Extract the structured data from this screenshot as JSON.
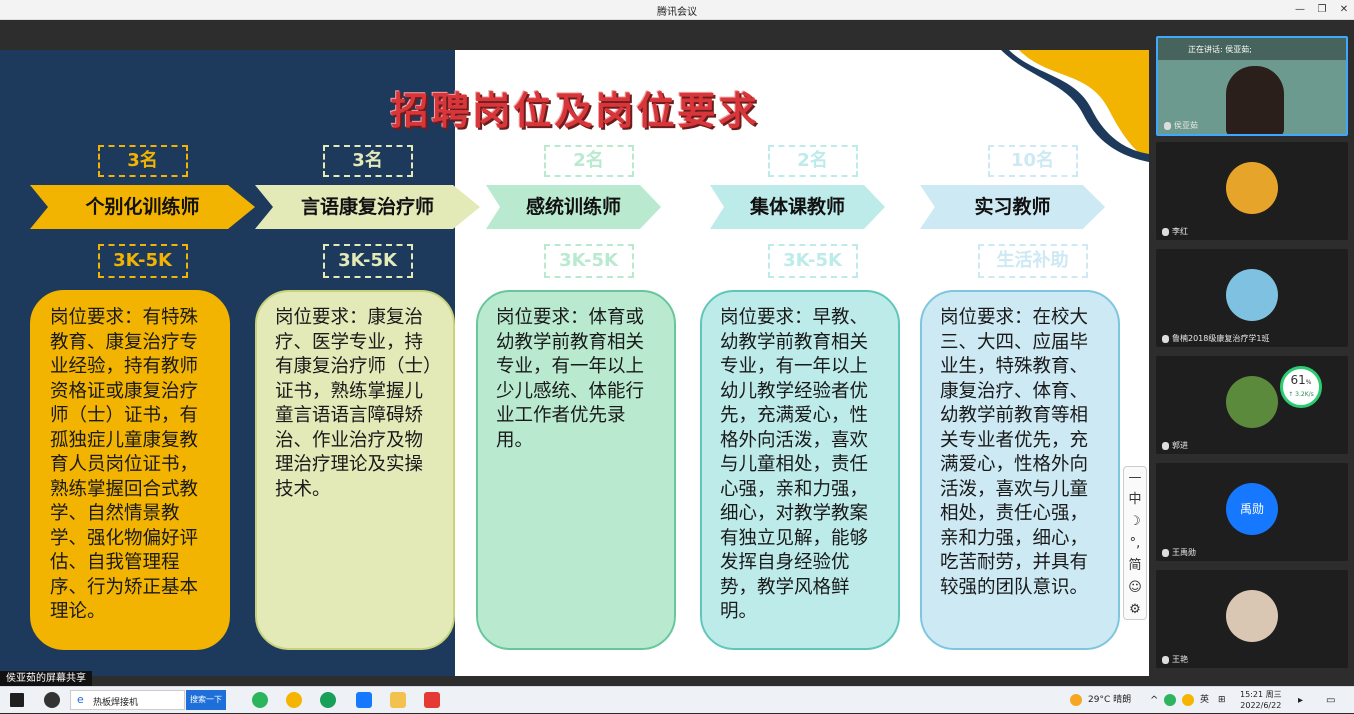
{
  "window": {
    "title": "腾讯会议"
  },
  "slide": {
    "title": "招聘岗位及岗位要求",
    "positions": [
      {
        "count": "3名",
        "name": "个别化训练师",
        "salary": "3K-5K",
        "requirement": "岗位要求：有特殊教育、康复治疗专业经验，持有教师资格证或康复治疗师（士）证书，有孤独症儿童康复教育人员岗位证书，熟练掌握回合式教学、自然情景教学、强化物偏好评估、自我管理程序、行为矫正基本理论。"
      },
      {
        "count": "3名",
        "name": "言语康复治疗师",
        "salary": "3K-5K",
        "requirement": "岗位要求：康复治疗、医学专业，持有康复治疗师（士）证书，熟练掌握儿童言语语言障碍矫治、作业治疗及物理治疗理论及实操技术。"
      },
      {
        "count": "2名",
        "name": "感统训练师",
        "salary": "3K-5K",
        "requirement": "岗位要求：体育或幼教学前教育相关专业，有一年以上少儿感统、体能行业工作者优先录用。"
      },
      {
        "count": "2名",
        "name": "集体课教师",
        "salary": "3K-5K",
        "requirement": "岗位要求：早教、幼教学前教育相关专业，有一年以上幼儿教学经验者优先，充满爱心，性格外向活泼，喜欢与儿童相处，责任心强，亲和力强，细心，对教学教案有独立见解，能够发挥自身经验优势，教学风格鲜明。"
      },
      {
        "count": "10名",
        "name": "实习教师",
        "salary": "生活补助",
        "requirement": "岗位要求：在校大三、大四、应届毕业生，特殊教育、康复治疗、体育、幼教学前教育等相关专业者优先，充满爱心，性格外向活泼，喜欢与儿童相处，责任心强，亲和力强，细心，吃苦耐劳，并具有较强的团队意识。"
      }
    ]
  },
  "colors": {
    "position_accents": [
      "#f2b400",
      "#e3eab8",
      "#b9ead0",
      "#bdebea",
      "#cde9f3"
    ],
    "card_borders": [
      "#f2b400",
      "#c7d27a",
      "#67c79a",
      "#5fc7b8",
      "#7ec6df"
    ]
  },
  "sidebar": {
    "speaking": "正在讲话: 侯亚茹;",
    "participants": [
      {
        "name": "侯亚茹"
      },
      {
        "name": "李红"
      },
      {
        "name": "鲁楠2018级康复治疗学1班"
      },
      {
        "name": "郭进",
        "net_percent": "61",
        "net_unit": "%",
        "net_speed": "↑ 3.2K/s"
      },
      {
        "name": "王禹勋",
        "avatar_text": "禹勋"
      },
      {
        "name": "王艳"
      }
    ]
  },
  "ime": [
    "中",
    "☽",
    "°,",
    "简",
    "☺",
    "⚙"
  ],
  "share_label": "侯亚茹的屏幕共享",
  "taskbar": {
    "search_text": "热板焊接机",
    "search_button": "搜索一下",
    "weather": "29°C 晴朗",
    "lang": "英",
    "time": "15:21 周三",
    "date": "2022/6/22"
  }
}
